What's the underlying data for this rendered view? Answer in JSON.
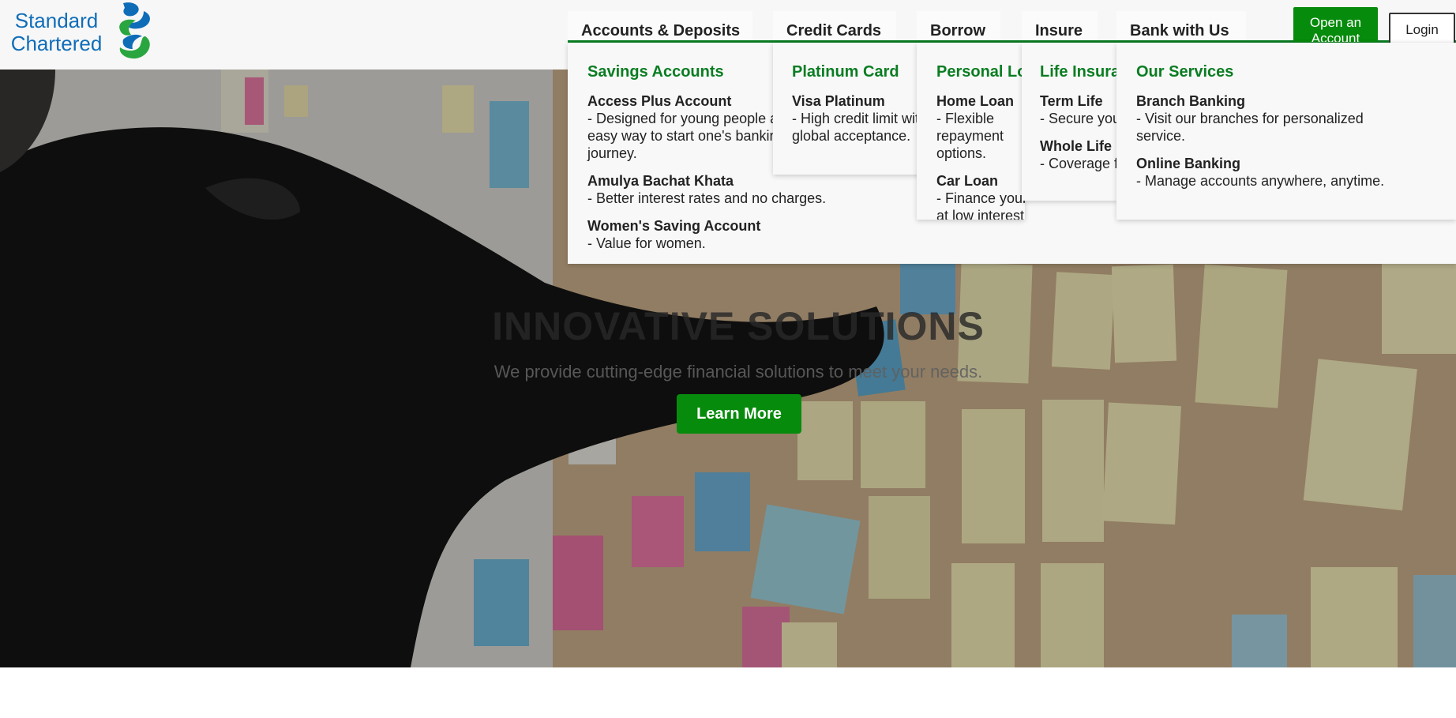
{
  "brand": {
    "line1": "Standard",
    "line2": "Chartered"
  },
  "colors": {
    "primary_green": "#078b0c",
    "nav_green": "#0a7d22",
    "logo_blue": "#0f6db8"
  },
  "nav": {
    "tabs": [
      "Accounts & Deposits",
      "Credit Cards",
      "Borrow",
      "Insure",
      "Bank with Us"
    ],
    "open_account": "Open an Account",
    "login": "Login"
  },
  "menus": {
    "accounts": {
      "heading": "Savings Accounts",
      "items": [
        {
          "title": "Access Plus Account",
          "desc": "- Designed for young people as an easy way to start one's banking journey."
        },
        {
          "title": "Amulya Bachat Khata",
          "desc": "- Better interest rates and no charges."
        },
        {
          "title": "Women's Saving Account",
          "desc": "- Value for women."
        }
      ]
    },
    "cards": {
      "heading": "Platinum Card",
      "items": [
        {
          "title": "Visa Platinum",
          "desc": "- High credit limit with global acceptance."
        }
      ]
    },
    "borrow": {
      "heading": "Personal Loans",
      "items": [
        {
          "title": "Home Loan",
          "desc": "- Flexible repayment options."
        },
        {
          "title": "Car Loan",
          "desc": "- Finance your car at low interest."
        }
      ]
    },
    "insure": {
      "heading": "Life Insurance",
      "items": [
        {
          "title": "Term Life",
          "desc": "- Secure your family's future."
        },
        {
          "title": "Whole Life",
          "desc": "- Coverage for life."
        }
      ]
    },
    "bank": {
      "heading": "Our Services",
      "items": [
        {
          "title": "Branch Banking",
          "desc": "- Visit our branches for personalized service."
        },
        {
          "title": "Online Banking",
          "desc": "- Manage accounts anywhere, anytime."
        }
      ]
    }
  },
  "hero": {
    "title": "INNOVATIVE SOLUTIONS",
    "subtitle": "We provide cutting-edge financial solutions to meet your needs.",
    "cta": "Learn More"
  }
}
